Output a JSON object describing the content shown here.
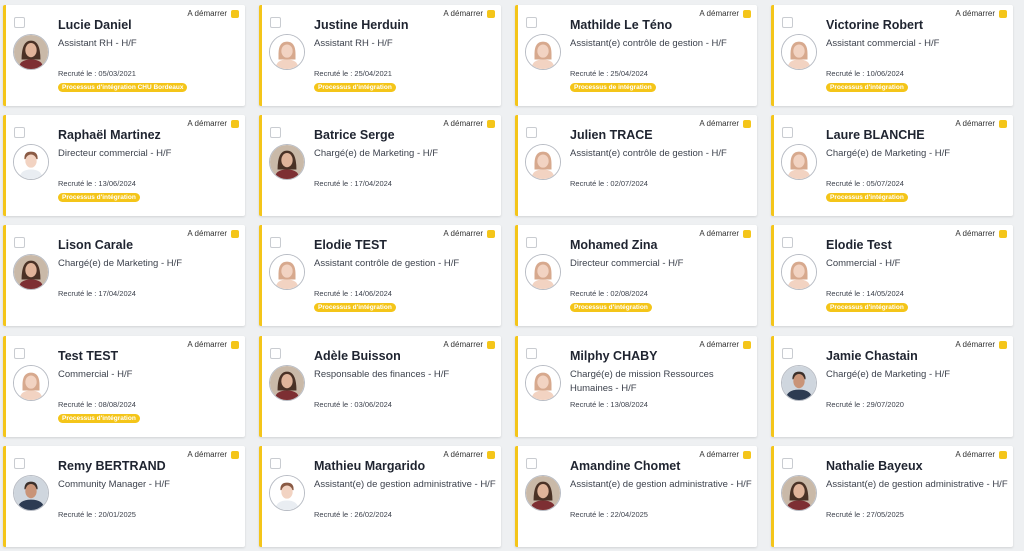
{
  "colors": {
    "accent": "#f4c519",
    "background": "#eef0f2",
    "card": "#ffffff"
  },
  "cards": [
    {
      "name": "Lucie Daniel",
      "role": "Assistant RH - H/F",
      "date": "Recruté le : 05/03/2021",
      "status": "A démarrer",
      "badge": "Processus d'intégration CHU Bordeaux",
      "avatar": "photo-woman-icon"
    },
    {
      "name": "Justine Herduin",
      "role": "Assistant RH - H/F",
      "date": "Recruté le : 25/04/2021",
      "status": "A démarrer",
      "badge": "Processus d'intégration",
      "avatar": "default-female-avatar-icon"
    },
    {
      "name": "Mathilde Le Téno",
      "role": "Assistant(e) contrôle de gestion - H/F",
      "date": "Recruté le : 25/04/2024",
      "status": "A démarrer",
      "badge": "Processus de intégration",
      "avatar": "default-female-avatar-icon"
    },
    {
      "name": "Victorine Robert",
      "role": "Assistant commercial - H/F",
      "date": "Recruté le : 10/06/2024",
      "status": "A démarrer",
      "badge": "Processus d'intégration",
      "avatar": "default-female-avatar-icon"
    },
    {
      "name": "Raphaël Martinez",
      "role": "Directeur commercial - H/F",
      "date": "Recruté le : 13/06/2024",
      "status": "A démarrer",
      "badge": "Processus d'intégration",
      "avatar": "default-male-avatar-icon"
    },
    {
      "name": "Batrice Serge",
      "role": "Chargé(e) de Marketing - H/F",
      "date": "Recruté le : 17/04/2024",
      "status": "A démarrer",
      "badge": "",
      "avatar": "photo-woman-icon"
    },
    {
      "name": "Julien TRACE",
      "role": "Assistant(e) contrôle de gestion - H/F",
      "date": "Recruté le : 02/07/2024",
      "status": "A démarrer",
      "badge": "",
      "avatar": "default-female-avatar-icon"
    },
    {
      "name": "Laure BLANCHE",
      "role": "Chargé(e) de Marketing - H/F",
      "date": "Recruté le : 05/07/2024",
      "status": "A démarrer",
      "badge": "Processus d'intégration",
      "avatar": "default-female-avatar-icon"
    },
    {
      "name": "Lison Carale",
      "role": "Chargé(e) de Marketing - H/F",
      "date": "Recruté le : 17/04/2024",
      "status": "A démarrer",
      "badge": "",
      "avatar": "photo-woman-icon"
    },
    {
      "name": "Elodie TEST",
      "role": "Assistant contrôle de gestion - H/F",
      "date": "Recruté le : 14/06/2024",
      "status": "A démarrer",
      "badge": "Processus d'intégration",
      "avatar": "default-female-avatar-icon"
    },
    {
      "name": "Mohamed Zina",
      "role": "Directeur commercial - H/F",
      "date": "Recruté le : 02/08/2024",
      "status": "A démarrer",
      "badge": "Processus d'intégration",
      "avatar": "default-female-avatar-icon"
    },
    {
      "name": "Elodie Test",
      "role": "Commercial - H/F",
      "date": "Recruté le : 14/05/2024",
      "status": "A démarrer",
      "badge": "Processus d'intégration",
      "avatar": "default-female-avatar-icon"
    },
    {
      "name": "Test TEST",
      "role": "Commercial - H/F",
      "date": "Recruté le : 08/08/2024",
      "status": "A démarrer",
      "badge": "Processus d'intégration",
      "avatar": "default-female-avatar-icon"
    },
    {
      "name": "Adèle Buisson",
      "role": "Responsable des finances - H/F",
      "date": "Recruté le : 03/06/2024",
      "status": "A démarrer",
      "badge": "",
      "avatar": "photo-woman-icon"
    },
    {
      "name": "Milphy CHABY",
      "role": "Chargé(e) de mission Ressources Humaines - H/F",
      "date": "Recruté le : 13/08/2024",
      "status": "A démarrer",
      "badge": "",
      "avatar": "default-female-avatar-icon"
    },
    {
      "name": "Jamie Chastain",
      "role": "Chargé(e) de Marketing - H/F",
      "date": "Recruté le : 29/07/2020",
      "status": "A démarrer",
      "badge": "",
      "avatar": "photo-man-icon"
    },
    {
      "name": "Remy BERTRAND",
      "role": "Community Manager - H/F",
      "date": "Recruté le : 20/01/2025",
      "status": "A démarrer",
      "badge": "",
      "avatar": "photo-man-icon"
    },
    {
      "name": "Mathieu Margarido",
      "role": "Assistant(e) de gestion administrative - H/F",
      "date": "Recruté le : 26/02/2024",
      "status": "A démarrer",
      "badge": "",
      "avatar": "default-male-avatar-icon"
    },
    {
      "name": "Amandine Chomet",
      "role": "Assistant(e) de gestion administrative - H/F",
      "date": "Recruté le : 22/04/2025",
      "status": "A démarrer",
      "badge": "",
      "avatar": "photo-woman-icon"
    },
    {
      "name": "Nathalie Bayeux",
      "role": "Assistant(e) de gestion administrative - H/F",
      "date": "Recruté le : 27/05/2025",
      "status": "A démarrer",
      "badge": "",
      "avatar": "photo-woman-icon"
    }
  ]
}
